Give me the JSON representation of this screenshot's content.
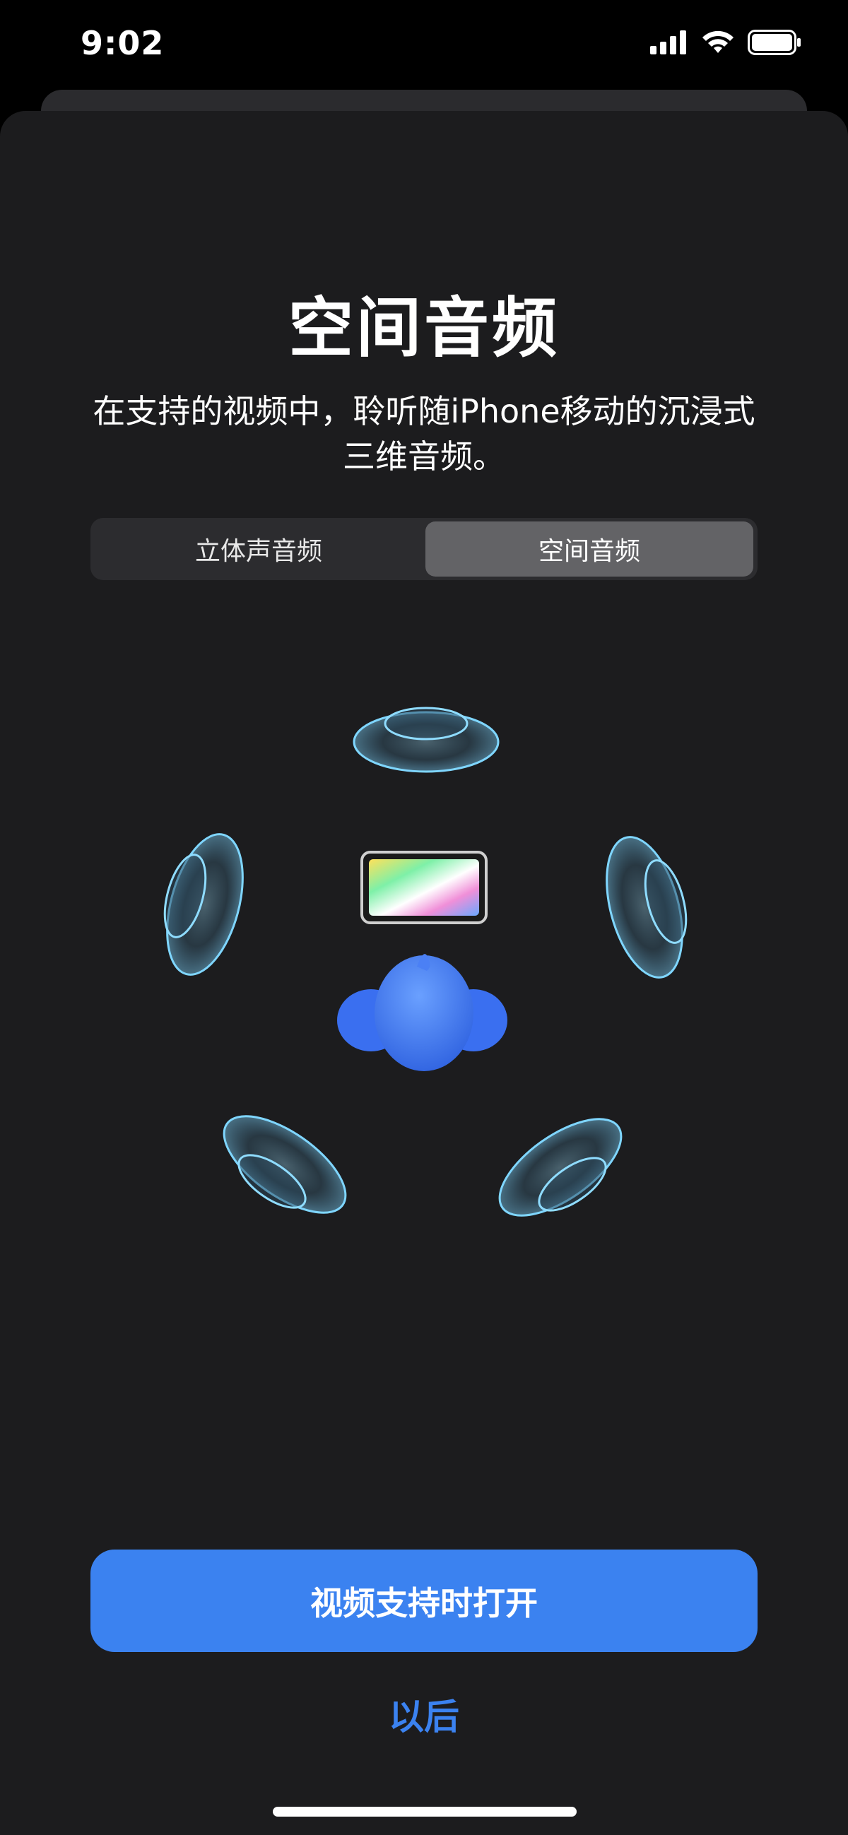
{
  "status_bar": {
    "time": "9:02",
    "icons": [
      "cellular-signal-icon",
      "wifi-icon",
      "battery-icon"
    ]
  },
  "sheet": {
    "title": "空间音频",
    "subtitle": "在支持的视频中，聆听随iPhone移动的沉浸式三维音频。",
    "segmented_control": {
      "options": [
        "立体声音频",
        "空间音频"
      ],
      "selected": "空间音频"
    },
    "illustration": {
      "icons": [
        "speaker-icon",
        "tablet-screen-icon",
        "listener-head-icon"
      ]
    },
    "primary_button_label": "视频支持时打开",
    "secondary_button_label": "以后"
  },
  "colors": {
    "background": "#1c1c1e",
    "accent": "#3b82f0",
    "segment_selected": "#636366",
    "speaker_glow": "#7fd6ff"
  }
}
